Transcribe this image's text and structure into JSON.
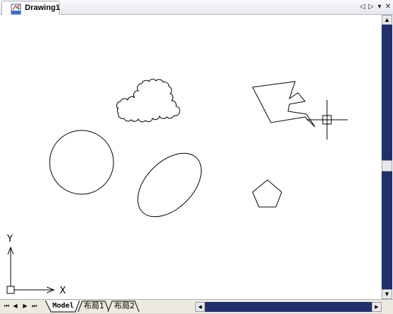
{
  "document": {
    "title": "Drawing1",
    "icon": "drawing-file-icon"
  },
  "title_controls": {
    "prev_symbol": "◁",
    "next_symbol": "▷",
    "menu_symbol": "▾",
    "close_symbol": "✕"
  },
  "drawing": {
    "shapes": [
      "revision-cloud",
      "polyline",
      "circle",
      "ellipse",
      "pentagon",
      "crosshair-cursor"
    ],
    "ucs_icon": {
      "x_label": "X",
      "y_label": "Y"
    }
  },
  "layout_tabs": [
    {
      "label": "Model",
      "active": true
    },
    {
      "label": "布局1",
      "active": false
    },
    {
      "label": "布局2",
      "active": false
    }
  ],
  "nav_buttons": [
    "⏮",
    "◀",
    "▶",
    "⏭"
  ],
  "scrollbars": {
    "up_symbol": "▲",
    "down_symbol": "▼",
    "left_symbol": "◀",
    "right_symbol": "▶"
  },
  "colors": {
    "canvas": "#ffffff",
    "linework": "#000000",
    "scrollbar_track": "#20306a"
  }
}
